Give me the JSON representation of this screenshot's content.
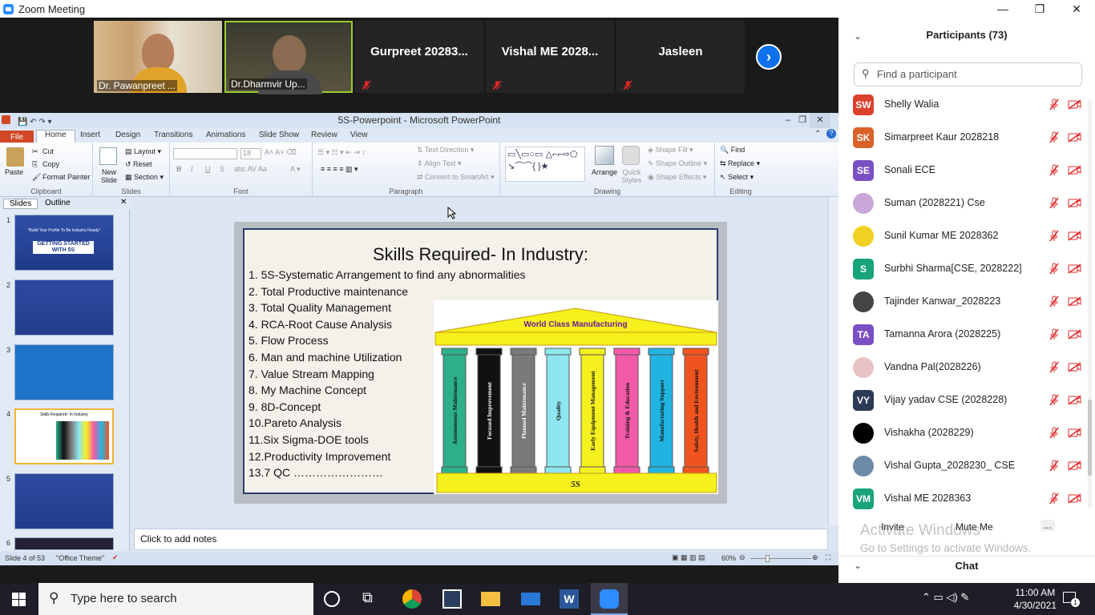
{
  "zoom": {
    "window_title": "Zoom Meeting",
    "tiles": [
      {
        "name": "Dr. Pawanpreet ...",
        "type": "video"
      },
      {
        "name": "Dr.Dharmvir Up...",
        "type": "video"
      },
      {
        "name": "Gurpreet 20283...",
        "type": "name"
      },
      {
        "name": "Vishal ME 2028...",
        "type": "name"
      },
      {
        "name": "Jasleen",
        "type": "name"
      }
    ],
    "next_icon": "chevron-right-icon"
  },
  "ppt": {
    "window_title": "5S-Powerpoint - Microsoft PowerPoint",
    "file_tab": "File",
    "tabs": [
      "Home",
      "Insert",
      "Design",
      "Transitions",
      "Animations",
      "Slide Show",
      "Review",
      "View"
    ],
    "ribbon": {
      "clipboard": {
        "paste": "Paste",
        "cut": "Cut",
        "copy": "Copy",
        "format_painter": "Format Painter",
        "label": "Clipboard"
      },
      "slides": {
        "new_slide": "New Slide",
        "layout": "Layout",
        "reset": "Reset",
        "section": "Section",
        "label": "Slides"
      },
      "font": {
        "size": "18",
        "label": "Font"
      },
      "paragraph": {
        "text_direction": "Text Direction",
        "align_text": "Align Text",
        "convert": "Convert to SmartArt",
        "label": "Paragraph"
      },
      "drawing": {
        "arrange": "Arrange",
        "quick_styles": "Quick Styles",
        "shape_fill": "Shape Fill",
        "shape_outline": "Shape Outline",
        "shape_effects": "Shape Effects",
        "label": "Drawing"
      },
      "editing": {
        "find": "Find",
        "replace": "Replace",
        "select": "Select",
        "label": "Editing"
      }
    },
    "panel_tabs": [
      "Slides",
      "Outline"
    ],
    "thumbnails": [
      {
        "num": "1",
        "title": "GETTING STARTED WITH 5S",
        "subtitle": "\"Build Your Profile To Be Industry Ready\""
      },
      {
        "num": "2"
      },
      {
        "num": "3"
      },
      {
        "num": "4",
        "title": "Skills Required- In Industry"
      },
      {
        "num": "5"
      },
      {
        "num": "6"
      }
    ],
    "slide": {
      "title": "Skills Required- In Industry:",
      "items": [
        "1. 5S-Systematic Arrangement to find any abnormalities",
        "2. Total Productive maintenance",
        "3. Total Quality Management",
        "4. RCA-Root Cause Analysis",
        "5. Flow Process",
        "6. Man and machine Utilization",
        "7. Value Stream Mapping",
        "8. My Machine Concept",
        "9. 8D-Concept",
        "10.Pareto Analysis",
        "11.Six Sigma-DOE tools",
        "12.Productivity Improvement",
        "13.7 QC ……………………"
      ],
      "graphic": {
        "roof_label": "World Class Manufacturing",
        "base_label": "5S",
        "pillars": [
          {
            "label": "Autonomous Maintenance",
            "color": "#2db08a"
          },
          {
            "label": "Focused Improvement",
            "color": "#111111"
          },
          {
            "label": "Planned Maintenance",
            "color": "#7a7a7a"
          },
          {
            "label": "Quality",
            "color": "#8ee6f0"
          },
          {
            "label": "Early Equipment Management",
            "color": "#f5f020"
          },
          {
            "label": "Training & Education",
            "color": "#f25aa8"
          },
          {
            "label": "Manufacturing Support",
            "color": "#22b4e0"
          },
          {
            "label": "Safety, Health and Environment",
            "color": "#f0541e"
          }
        ]
      }
    },
    "notes_placeholder": "Click to add notes",
    "status": {
      "slide": "Slide 4 of 53",
      "theme": "\"Office Theme\"",
      "zoom": "60%"
    }
  },
  "participants": {
    "title": "Participants (73)",
    "search_placeholder": "Find a participant",
    "list": [
      {
        "initials": "SW",
        "name": "Shelly Walia",
        "color": "#d9412e"
      },
      {
        "initials": "SK",
        "name": "Simarpreet Kaur 2028218",
        "color": "#d9622b"
      },
      {
        "initials": "SE",
        "name": "Sonali ECE",
        "color": "#7a4fc4"
      },
      {
        "initials": "",
        "name": "Suman (2028221) Cse",
        "color": "#c9a6d8"
      },
      {
        "initials": "",
        "name": "Sunil Kumar ME 2028362",
        "color": "#f0d020"
      },
      {
        "initials": "S",
        "name": "Surbhi Sharma[CSE, 2028222]",
        "color": "#19a37a"
      },
      {
        "initials": "",
        "name": "Tajinder Kanwar_2028223",
        "color": "#444444"
      },
      {
        "initials": "TA",
        "name": "Tamanna Arora (2028225)",
        "color": "#7a4fc4"
      },
      {
        "initials": "",
        "name": "Vandna Pal(2028226)",
        "color": "#e7c3c3"
      },
      {
        "initials": "VY",
        "name": "Vijay yadav CSE (2028228)",
        "color": "#2b3a55"
      },
      {
        "initials": "",
        "name": "Vishakha (2028229)",
        "color": "#000000"
      },
      {
        "initials": "",
        "name": "Vishal Gupta_2028230_ CSE",
        "color": "#6d8aa8"
      },
      {
        "initials": "VM",
        "name": "Vishal ME 2028363",
        "color": "#19a37a"
      }
    ],
    "invite": "Invite",
    "mute_me": "Mute Me",
    "more": "...",
    "watermark_title": "Activate Windows",
    "watermark_sub": "Go to Settings to activate Windows.",
    "chat": "Chat"
  },
  "taskbar": {
    "search": "Type here to search",
    "time": "11:00 AM",
    "date": "4/30/2021",
    "notification_count": "1"
  }
}
